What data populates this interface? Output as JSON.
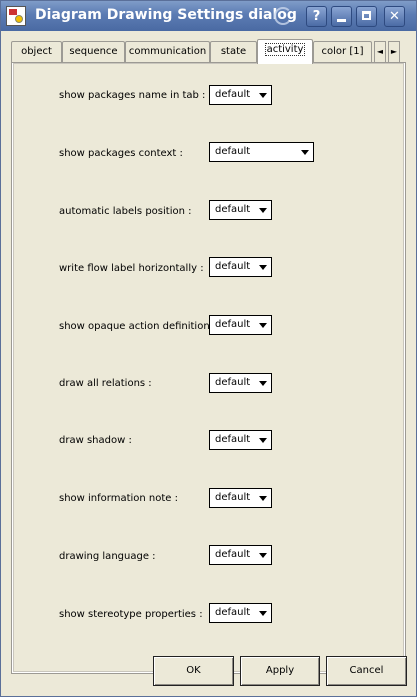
{
  "window": {
    "title": "Diagram Drawing Settings dialog",
    "title_buttons": {
      "help": "?",
      "close": "✕"
    }
  },
  "tabs": [
    {
      "label": "object",
      "active": false
    },
    {
      "label": "sequence",
      "active": false
    },
    {
      "label": "communication",
      "active": false
    },
    {
      "label": "state",
      "active": false
    },
    {
      "label": "activity",
      "active": true
    },
    {
      "label": "color [1]",
      "active": false
    }
  ],
  "tab_scroll": {
    "left": "◄",
    "right": "►"
  },
  "settings": [
    {
      "label": "show packages name in tab :",
      "value": "default"
    },
    {
      "label": "show packages context :",
      "value": "default"
    },
    {
      "label": "automatic labels position :",
      "value": "default"
    },
    {
      "label": "write flow label horizontally :",
      "value": "default"
    },
    {
      "label": "show opaque action definition :",
      "value": "default"
    },
    {
      "label": "draw all relations :",
      "value": "default"
    },
    {
      "label": "draw shadow :",
      "value": "default"
    },
    {
      "label": "show information note :",
      "value": "default"
    },
    {
      "label": "drawing language :",
      "value": "default"
    },
    {
      "label": "show stereotype properties :",
      "value": "default"
    }
  ],
  "buttons": {
    "ok": "OK",
    "apply": "Apply",
    "cancel": "Cancel"
  },
  "colors": {
    "titlebar": "#5b7bb3",
    "dialog_bg": "#ece9d8"
  }
}
